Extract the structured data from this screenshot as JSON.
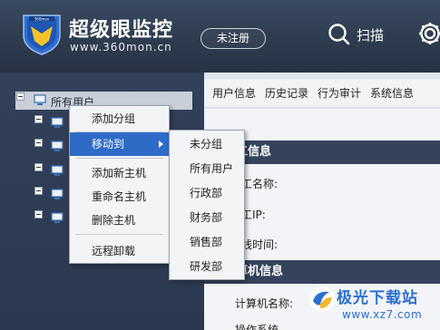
{
  "header": {
    "logo_text": "360mon",
    "brand_name": "超级眼监控",
    "brand_url": "www.360mon.cn",
    "register_label": "未注册",
    "scan_label": "扫描",
    "scan_icon": "search-icon",
    "settings_icon": "gear-icon"
  },
  "tree": {
    "root_label": "所有用户"
  },
  "tabs": [
    "用户信息",
    "历史记录",
    "行为审计",
    "系统信息"
  ],
  "sections": {
    "employee_title": "工信息",
    "employee_fields": [
      "工名称:",
      "工IP:",
      "线时间:"
    ],
    "computer_title": "算机信息",
    "computer_fields": [
      "计算机名称:",
      "操作系统"
    ]
  },
  "context_menu": {
    "items": [
      "添加分组",
      "移动到",
      "添加新主机",
      "重命名主机",
      "删除主机",
      "远程卸载"
    ],
    "active_item": "移动到"
  },
  "submenu": {
    "items": [
      "未分组",
      "所有用户",
      "行政部",
      "财务部",
      "销售部",
      "研发部"
    ]
  },
  "watermark": {
    "title": "极光下载站",
    "url": "www.xz7.com"
  },
  "colors": {
    "header_bg": "#2d3a4d",
    "menu_highlight": "#2e6bc6",
    "section_header": "#34435b",
    "watermark": "#2a6fd1"
  }
}
